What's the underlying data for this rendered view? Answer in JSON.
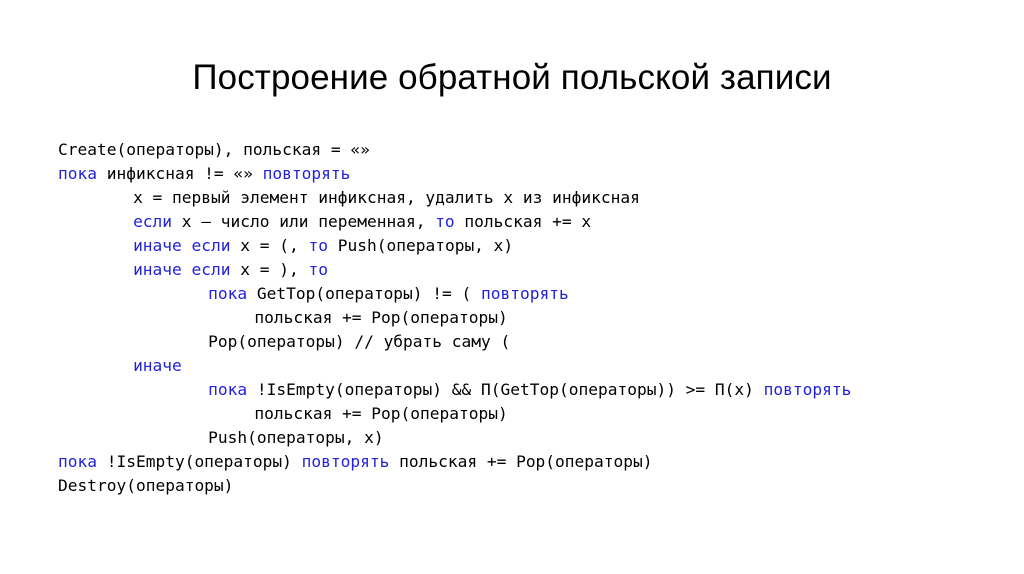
{
  "slide": {
    "title": "Построение обратной польской записи",
    "background_color": "#ffffff",
    "text_color": "#000000",
    "keyword_color": "#2222dd"
  },
  "code": {
    "lines": [
      {
        "indent": 0,
        "segments": [
          {
            "text": "Create(операторы), польская = «»",
            "kw": false
          }
        ]
      },
      {
        "indent": 0,
        "segments": [
          {
            "text": "пока",
            "kw": true
          },
          {
            "text": " инфиксная != «» ",
            "kw": false
          },
          {
            "text": "повторять",
            "kw": true
          }
        ]
      },
      {
        "indent": 6.5,
        "segments": [
          {
            "text": "x = первый элемент инфиксная, удалить x из инфиксная",
            "kw": false
          }
        ]
      },
      {
        "indent": 6.5,
        "segments": [
          {
            "text": "если",
            "kw": true
          },
          {
            "text": " x – число или переменная, ",
            "kw": false
          },
          {
            "text": "то",
            "kw": true
          },
          {
            "text": " польская += x",
            "kw": false
          }
        ]
      },
      {
        "indent": 6.5,
        "segments": [
          {
            "text": "иначе если",
            "kw": true
          },
          {
            "text": " x = (, ",
            "kw": false
          },
          {
            "text": "то",
            "kw": true
          },
          {
            "text": " Push(операторы, x)",
            "kw": false
          }
        ]
      },
      {
        "indent": 6.5,
        "segments": [
          {
            "text": "иначе если",
            "kw": true
          },
          {
            "text": " x = ), ",
            "kw": false
          },
          {
            "text": "то",
            "kw": true
          }
        ]
      },
      {
        "indent": 13,
        "segments": [
          {
            "text": "пока",
            "kw": true
          },
          {
            "text": " GetTop(операторы) != ( ",
            "kw": false
          },
          {
            "text": "повторять",
            "kw": true
          }
        ]
      },
      {
        "indent": 17,
        "segments": [
          {
            "text": "польская += Pop(операторы)",
            "kw": false
          }
        ]
      },
      {
        "indent": 13,
        "segments": [
          {
            "text": "Pop(операторы) // убрать саму (",
            "kw": false
          }
        ]
      },
      {
        "indent": 6.5,
        "segments": [
          {
            "text": "иначе",
            "kw": true
          }
        ]
      },
      {
        "indent": 13,
        "segments": [
          {
            "text": "пока",
            "kw": true
          },
          {
            "text": " !IsEmpty(операторы) && П(GetTop(операторы)) >= П(x) ",
            "kw": false
          },
          {
            "text": "повторять",
            "kw": true
          }
        ]
      },
      {
        "indent": 17,
        "segments": [
          {
            "text": "польская += Pop(операторы)",
            "kw": false
          }
        ]
      },
      {
        "indent": 13,
        "segments": [
          {
            "text": "Push(операторы, x)",
            "kw": false
          }
        ]
      },
      {
        "indent": 0,
        "segments": [
          {
            "text": "пока",
            "kw": true
          },
          {
            "text": " !IsEmpty(операторы) ",
            "kw": false
          },
          {
            "text": "повторять",
            "kw": true
          },
          {
            "text": " польская += Pop(операторы)",
            "kw": false
          }
        ]
      },
      {
        "indent": 0,
        "segments": [
          {
            "text": "Destroy(операторы)",
            "kw": false
          }
        ]
      }
    ]
  }
}
